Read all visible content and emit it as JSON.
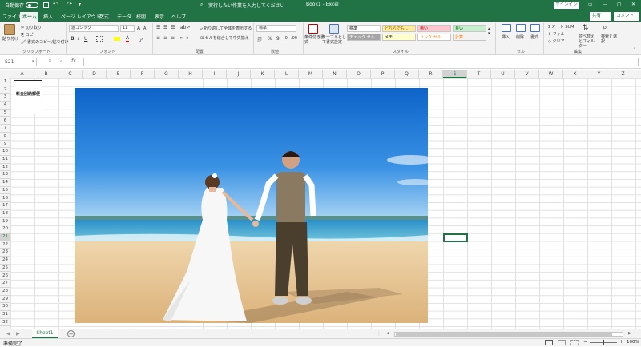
{
  "title_bar": {
    "autosave_label": "自動保存",
    "autosave_state": "オフ",
    "search_placeholder": "実行したい作業を入力してください",
    "document_title": "Book1 - Excel",
    "signin_label": "サインイン"
  },
  "menu": {
    "tabs": [
      "ファイル",
      "ホーム",
      "挿入",
      "ページ レイアウト",
      "数式",
      "データ",
      "校閲",
      "表示",
      "ヘルプ"
    ],
    "active_tab": "ホーム",
    "share_label": "共有",
    "comment_label": "コメント"
  },
  "ribbon": {
    "clipboard": {
      "paste_label": "貼り付け",
      "cut_label": "切り取り",
      "copy_label": "コピー",
      "format_painter_label": "書式のコピー/貼り付け",
      "group_label": "クリップボード"
    },
    "font": {
      "font_name": "游ゴシック",
      "font_size": "11",
      "group_label": "フォント"
    },
    "alignment": {
      "wrap_label": "折り返して全体を表示する",
      "merge_label": "セルを結合して中央揃え",
      "group_label": "配置"
    },
    "number": {
      "format": "標準",
      "group_label": "数値"
    },
    "styles": {
      "cond_format_label": "条件付き書式",
      "table_label": "テーブルとして書式設定",
      "cells": [
        {
          "label": "標準",
          "bg": "#ffffff",
          "fg": "#000000"
        },
        {
          "label": "どちらでも...",
          "bg": "#ffeb9c",
          "fg": "#9c5700"
        },
        {
          "label": "悪い",
          "bg": "#ffc7ce",
          "fg": "#9c0006"
        },
        {
          "label": "良い",
          "bg": "#c6efce",
          "fg": "#006100"
        },
        {
          "label": "チェック セル",
          "bg": "#a5a5a5",
          "fg": "#ffffff"
        },
        {
          "label": "メモ",
          "bg": "#ffffcc",
          "fg": "#000000"
        },
        {
          "label": "リンク セル",
          "bg": "#ffffff",
          "fg": "#fa7d00"
        },
        {
          "label": "計算",
          "bg": "#f2f2f2",
          "fg": "#fa7d00"
        }
      ],
      "group_label": "スタイル"
    },
    "cells": {
      "insert_label": "挿入",
      "delete_label": "削除",
      "format_label": "書式",
      "group_label": "セル"
    },
    "editing": {
      "autosum_label": "オート SUM",
      "fill_label": "フィル",
      "clear_label": "クリア",
      "sort_label": "並べ替えとフィルター",
      "find_label": "検索と選択",
      "group_label": "編集"
    }
  },
  "formula_bar": {
    "name_box": "S21",
    "fx_label": "fx",
    "formula": ""
  },
  "sheet": {
    "columns": [
      "A",
      "B",
      "C",
      "D",
      "E",
      "F",
      "G",
      "H",
      "I",
      "J",
      "K",
      "L",
      "M",
      "N",
      "O",
      "P",
      "Q",
      "R",
      "S",
      "T",
      "U",
      "V",
      "W",
      "X",
      "Y",
      "Z"
    ],
    "rows": [
      "1",
      "2",
      "3",
      "4",
      "5",
      "6",
      "7",
      "8",
      "9",
      "10",
      "11",
      "12",
      "13",
      "14",
      "15",
      "16",
      "17",
      "18",
      "19",
      "20",
      "21",
      "22",
      "23",
      "24",
      "25",
      "26",
      "27",
      "28",
      "29",
      "30",
      "31",
      "32"
    ],
    "selected_column": "S",
    "selected_row": "21",
    "stamp_text": "料金別納郵便",
    "tab_name": "Sheet1"
  },
  "status_bar": {
    "status": "準備完了",
    "zoom": "100%"
  },
  "colors": {
    "accent": "#217346",
    "sky": "#1a73d0",
    "sea": "#3aa6d6",
    "sand": "#e8c89a"
  }
}
